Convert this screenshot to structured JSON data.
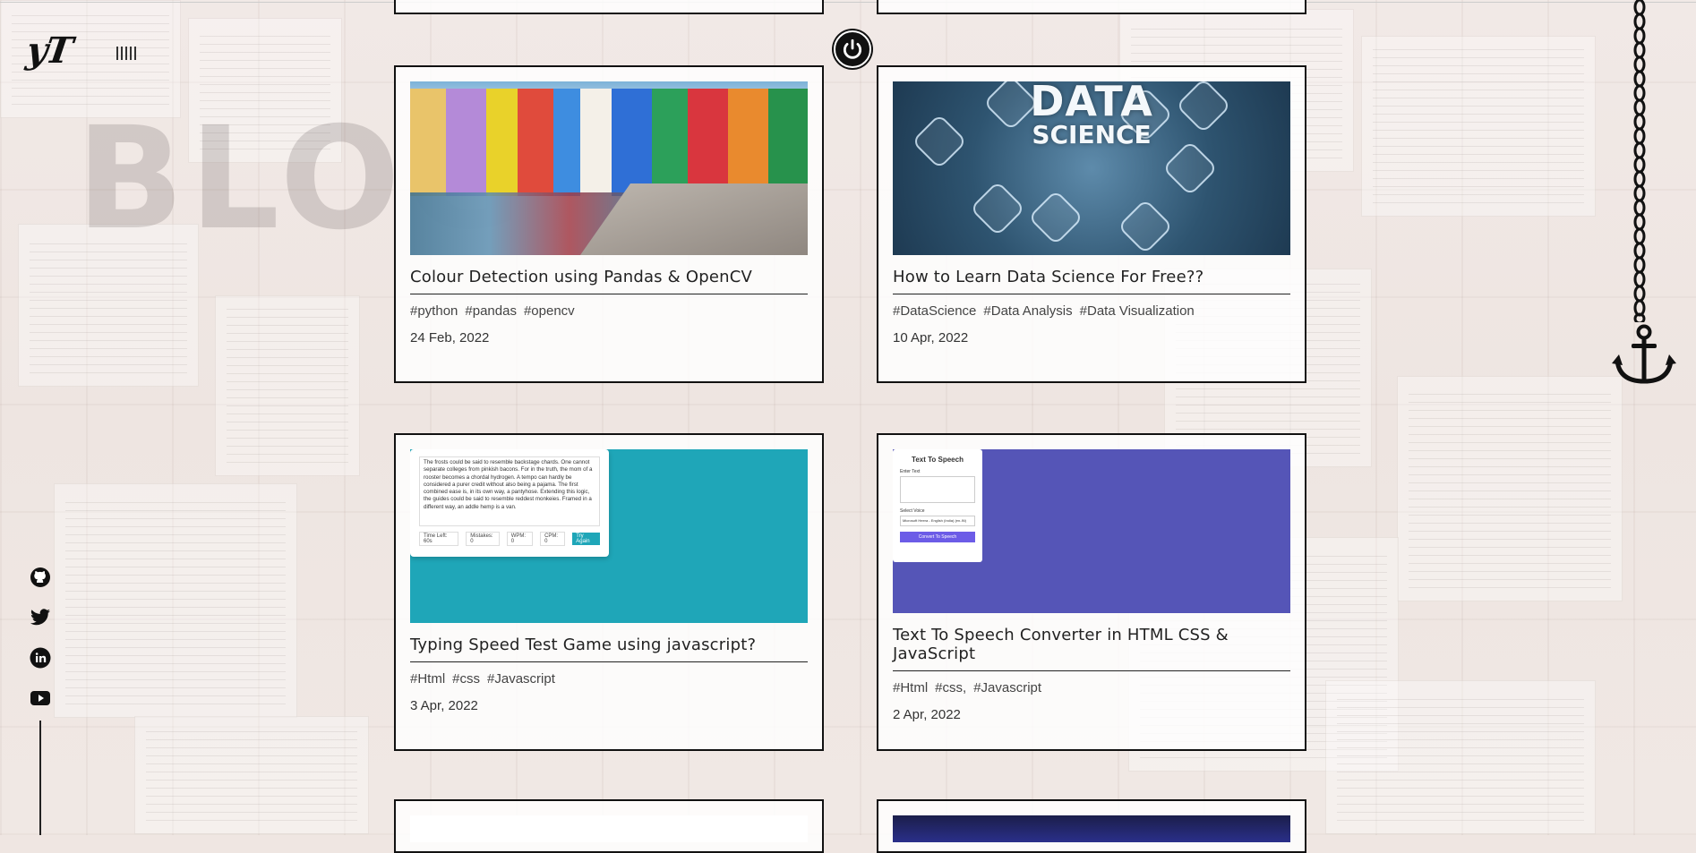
{
  "site": {
    "logo": "yT",
    "background_word": "BLOG"
  },
  "icons": {
    "menu": "menu-bars-icon",
    "power": "power-icon",
    "social": [
      "github-icon",
      "twitter-icon",
      "linkedin-icon",
      "youtube-icon"
    ],
    "chain": "chain-icon",
    "anchor": "anchor-icon"
  },
  "posts": [
    {
      "title": "Colour Detection using Pandas & OpenCV",
      "tags": [
        "#python",
        "#pandas",
        "#opencv"
      ],
      "date": "24 Feb, 2022"
    },
    {
      "title": "How to Learn Data Science For Free??",
      "tags": [
        "#DataScience",
        "#Data Analysis",
        "#Data Visualization"
      ],
      "date": "10 Apr, 2022",
      "thumbnail_text": [
        "DATA",
        "SCIENCE"
      ]
    },
    {
      "title": "Typing Speed Test Game using javascript?",
      "tags": [
        "#Html",
        "#css",
        "#Javascript"
      ],
      "date": "3 Apr, 2022",
      "thumbnail_text": "The frosts could be said to resemble backstage chards. One cannot separate colleges from pinkish bacons. For in the truth, the mom of a rooster becomes a chordal hydrogen. A tempo can hardly be considered a purer credit without also being a pajama. The first combined ease is, in its own way, a pantyhose. Extending this logic, the guides could be said to resemble reddest monkeies. Framed in a different way, an addle hemp is a van.",
      "thumbnail_stats": [
        "Time Left: 60s",
        "Mistakes: 0",
        "WPM: 0",
        "CPM: 0"
      ],
      "thumbnail_button": "Try Again"
    },
    {
      "title": "Text To Speech Converter in HTML CSS & JavaScript",
      "tags": [
        "#Html",
        "#css,",
        "#Javascript"
      ],
      "date": "2 Apr, 2022",
      "thumbnail_heading": "Text To Speech",
      "thumbnail_label1": "Enter Text",
      "thumbnail_label2": "Select Voice",
      "thumbnail_select": "Microsoft Heera - English (India) (en-IN)",
      "thumbnail_button": "Convert To Speech"
    }
  ]
}
